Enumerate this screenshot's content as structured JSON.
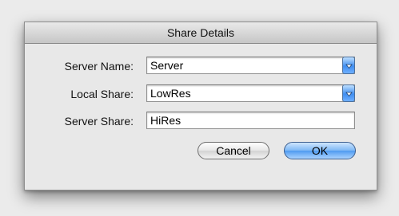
{
  "dialog": {
    "title": "Share Details"
  },
  "fields": {
    "server_name": {
      "label": "Server Name:",
      "value": "Server"
    },
    "local_share": {
      "label": "Local Share:",
      "value": "LowRes"
    },
    "server_share": {
      "label": "Server Share:",
      "value": "HiRes"
    }
  },
  "buttons": {
    "cancel_label": "Cancel",
    "ok_label": "OK"
  },
  "colors": {
    "accent": "#4f9af0",
    "window_bg": "#e8e8e8"
  }
}
